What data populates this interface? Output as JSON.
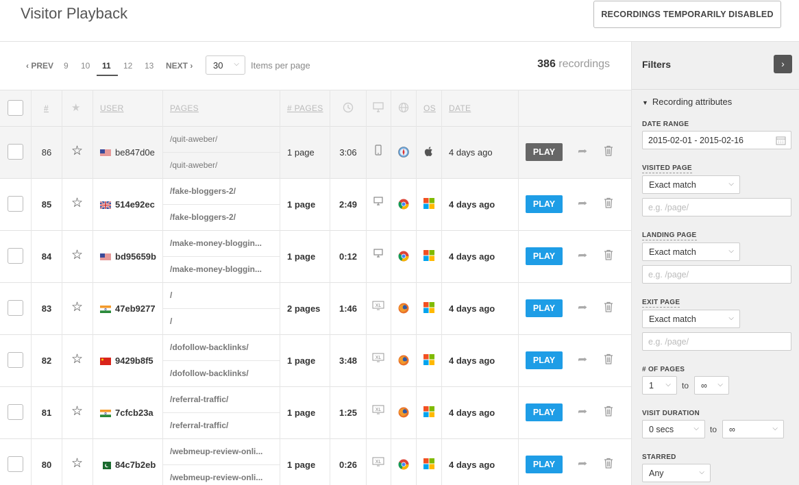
{
  "header": {
    "title": "Visitor Playback",
    "disabled_button": "RECORDINGS TEMPORARILY DISABLED"
  },
  "pager": {
    "prev": "‹ PREV",
    "pages": [
      "9",
      "10",
      "11",
      "12",
      "13"
    ],
    "current": "11",
    "next": "NEXT ›",
    "items_per_page_value": "30",
    "items_per_page_label": "Items per page",
    "count": "386",
    "count_label": "recordings"
  },
  "table": {
    "headers": {
      "num": "#",
      "user": "USER",
      "pages": "PAGES",
      "num_pages": "# PAGES",
      "os": "OS",
      "date": "DATE"
    },
    "header_icons": [
      "star-icon",
      "clock-icon",
      "monitor-icon",
      "globe-icon"
    ],
    "rows": [
      {
        "num": "86",
        "flag": "us",
        "user": "be847d0e",
        "page_a": "/quit-aweber/",
        "page_b": "/quit-aweber/",
        "pages": "1 page",
        "duration": "3:06",
        "device": "mobile",
        "browser": "safari",
        "os": "apple",
        "date": "4 days ago",
        "play": "PLAY",
        "highlighted": true,
        "bold": false
      },
      {
        "num": "85",
        "flag": "gb",
        "user": "514e92ec",
        "page_a": "/fake-bloggers-2/",
        "page_b": "/fake-bloggers-2/",
        "pages": "1 page",
        "duration": "2:49",
        "device": "desktop",
        "browser": "chrome",
        "os": "windows",
        "date": "4 days ago",
        "play": "PLAY",
        "highlighted": false,
        "bold": true
      },
      {
        "num": "84",
        "flag": "us",
        "user": "bd95659b",
        "page_a": "/make-money-bloggin...",
        "page_b": "/make-money-bloggin...",
        "pages": "1 page",
        "duration": "0:12",
        "device": "desktop",
        "browser": "chrome",
        "os": "windows",
        "date": "4 days ago",
        "play": "PLAY",
        "highlighted": false,
        "bold": true
      },
      {
        "num": "83",
        "flag": "in",
        "user": "47eb9277",
        "page_a": "/",
        "page_b": "/",
        "pages": "2 pages",
        "duration": "1:46",
        "device": "xl",
        "browser": "firefox",
        "os": "windows",
        "date": "4 days ago",
        "play": "PLAY",
        "highlighted": false,
        "bold": true
      },
      {
        "num": "82",
        "flag": "cn",
        "user": "9429b8f5",
        "page_a": "/dofollow-backlinks/",
        "page_b": "/dofollow-backlinks/",
        "pages": "1 page",
        "duration": "3:48",
        "device": "xl",
        "browser": "firefox",
        "os": "windows",
        "date": "4 days ago",
        "play": "PLAY",
        "highlighted": false,
        "bold": true
      },
      {
        "num": "81",
        "flag": "in",
        "user": "7cfcb23a",
        "page_a": "/referral-traffic/",
        "page_b": "/referral-traffic/",
        "pages": "1 page",
        "duration": "1:25",
        "device": "xl",
        "browser": "firefox",
        "os": "windows",
        "date": "4 days ago",
        "play": "PLAY",
        "highlighted": false,
        "bold": true
      },
      {
        "num": "80",
        "flag": "pk",
        "user": "84c7b2eb",
        "page_a": "/webmeup-review-onli...",
        "page_b": "/webmeup-review-onli...",
        "pages": "1 page",
        "duration": "0:26",
        "device": "xl",
        "browser": "chrome",
        "os": "windows",
        "date": "4 days ago",
        "play": "PLAY",
        "highlighted": false,
        "bold": true
      }
    ]
  },
  "filters": {
    "title": "Filters",
    "section": "Recording attributes",
    "date_range_label": "DATE RANGE",
    "date_range_value": "2015-02-01 - 2015-02-16",
    "visited_label": "VISITED PAGE",
    "visited_match": "Exact match",
    "visited_placeholder": "e.g. /page/",
    "landing_label": "LANDING PAGE",
    "landing_match": "Exact match",
    "landing_placeholder": "e.g. /page/",
    "exit_label": "EXIT PAGE",
    "exit_match": "Exact match",
    "exit_placeholder": "e.g. /page/",
    "num_pages_label": "# OF PAGES",
    "num_pages_from": "1",
    "to": "to",
    "num_pages_to": "∞",
    "duration_label": "VISIT DURATION",
    "duration_from": "0 secs",
    "duration_to": "∞",
    "starred_label": "STARRED",
    "starred_value": "Any"
  },
  "colors": {
    "play_blue": "#1e9de6",
    "play_gray": "#666666",
    "filters_bg": "#f0f0f0"
  }
}
